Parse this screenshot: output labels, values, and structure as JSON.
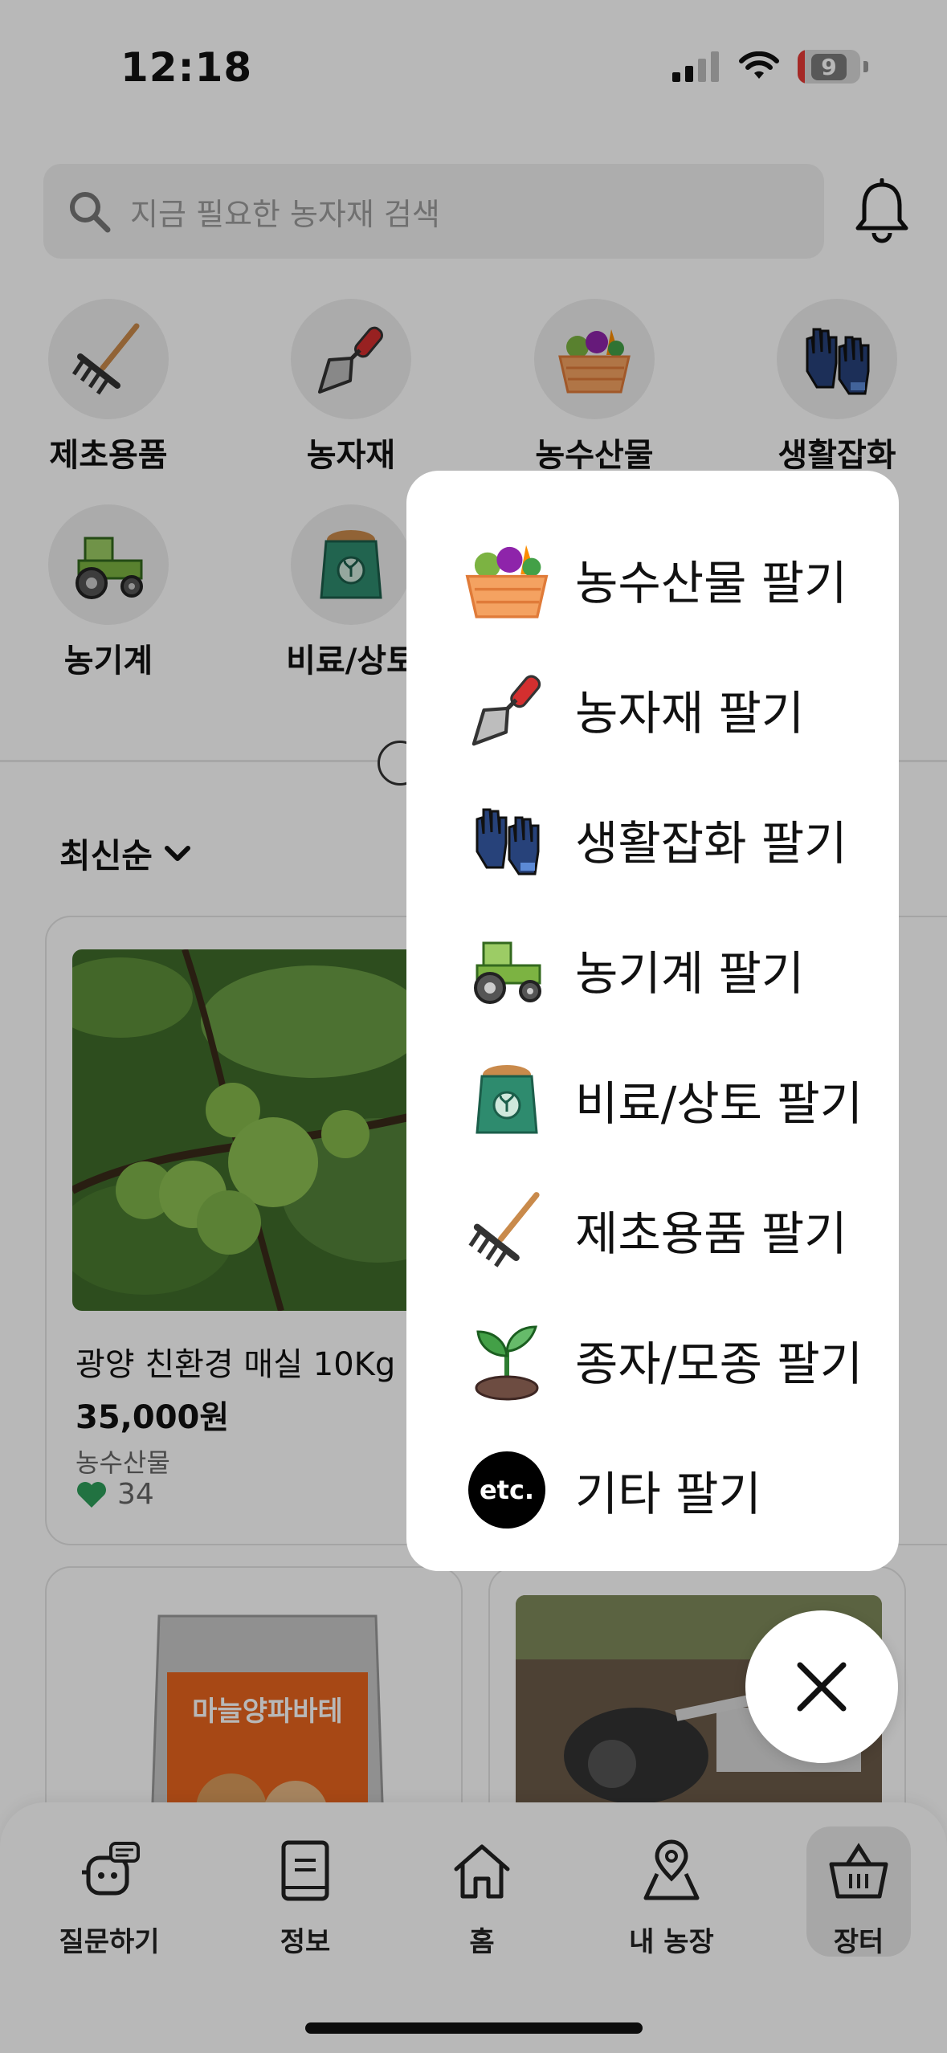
{
  "status_bar": {
    "time": "12:18",
    "battery_level": "9"
  },
  "search": {
    "placeholder": "지금 필요한 농자재 검색"
  },
  "categories": [
    {
      "label": "제초용품",
      "icon": "rake-icon"
    },
    {
      "label": "농자재",
      "icon": "trowel-icon"
    },
    {
      "label": "농수산물",
      "icon": "vegetable-basket-icon"
    },
    {
      "label": "생활잡화",
      "icon": "gloves-icon"
    },
    {
      "label": "농기계",
      "icon": "tractor-icon"
    },
    {
      "label": "비료/상토",
      "icon": "fertilizer-bag-icon"
    }
  ],
  "sort": {
    "label": "최신순"
  },
  "products": [
    {
      "name": "광양 친환경 매실 10Kg",
      "price": "35,000원",
      "category": "농수산물",
      "likes": "34"
    },
    {
      "name": "",
      "price": "",
      "category": "",
      "likes": "",
      "package_title": "마늘양파바테"
    },
    {
      "name": "",
      "price": "",
      "category": "",
      "likes": ""
    }
  ],
  "sell_menu": {
    "items": [
      {
        "label": "농수산물 팔기",
        "icon": "vegetable-basket-icon"
      },
      {
        "label": "농자재 팔기",
        "icon": "trowel-icon"
      },
      {
        "label": "생활잡화 팔기",
        "icon": "gloves-icon"
      },
      {
        "label": "농기계 팔기",
        "icon": "tractor-icon"
      },
      {
        "label": "비료/상토 팔기",
        "icon": "fertilizer-bag-icon"
      },
      {
        "label": "제초용품 팔기",
        "icon": "rake-icon"
      },
      {
        "label": "종자/모종 팔기",
        "icon": "sprout-icon"
      },
      {
        "label": "기타 팔기",
        "icon": "etc-icon",
        "icon_text": "etc."
      }
    ]
  },
  "tabbar": {
    "items": [
      {
        "label": "질문하기",
        "icon": "robot-chat-icon"
      },
      {
        "label": "정보",
        "icon": "book-icon"
      },
      {
        "label": "홈",
        "icon": "home-icon"
      },
      {
        "label": "내 농장",
        "icon": "map-pin-icon"
      },
      {
        "label": "장터",
        "icon": "basket-icon",
        "active": true
      }
    ]
  },
  "colors": {
    "like_heart": "#2e9e5b",
    "overlay": "rgba(0,0,0,0.28)",
    "battery_low": "#e53935"
  }
}
